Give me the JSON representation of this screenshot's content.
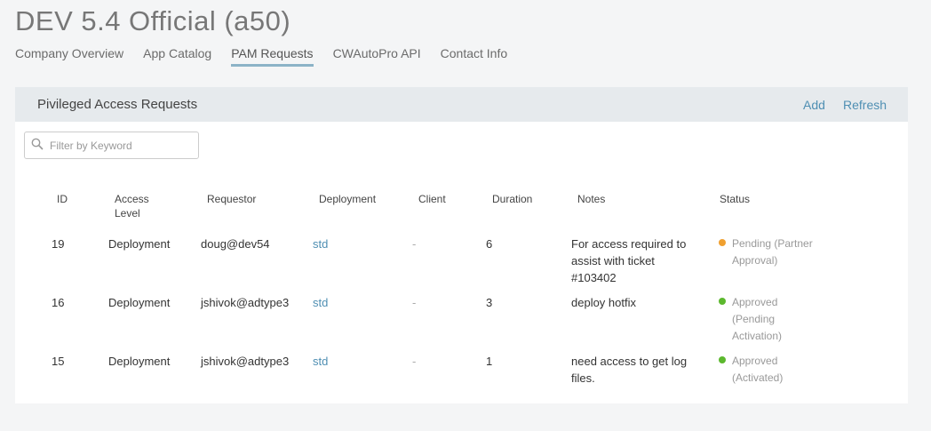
{
  "app": {
    "title": "DEV 5.4 Official (a50)"
  },
  "tabs": [
    {
      "label": "Company Overview"
    },
    {
      "label": "App Catalog"
    },
    {
      "label": "PAM Requests"
    },
    {
      "label": "CWAutoPro API"
    },
    {
      "label": "Contact Info"
    }
  ],
  "active_tab": "PAM Requests",
  "panel": {
    "title": "Pivileged Access Requests",
    "add_label": "Add",
    "refresh_label": "Refresh"
  },
  "search": {
    "placeholder": "Filter by Keyword",
    "value": ""
  },
  "columns": [
    "ID",
    "Access\nLevel",
    "Requestor",
    "Deployment",
    "Client",
    "Duration",
    "Notes",
    "Status"
  ],
  "rows": [
    {
      "id": "19",
      "access_level": "Deployment",
      "requestor": "doug@dev54",
      "deployment": "std",
      "client": "-",
      "duration": "6",
      "notes": "For access required to assist with ticket #103402",
      "status": "Pending (Partner Approval)",
      "status_color": "#f0a030"
    },
    {
      "id": "16",
      "access_level": "Deployment",
      "requestor": "jshivok@adtype3",
      "deployment": "std",
      "client": "-",
      "duration": "3",
      "notes": "deploy hotfix",
      "status": "Approved (Pending Activation)",
      "status_color": "#5cb82e"
    },
    {
      "id": "15",
      "access_level": "Deployment",
      "requestor": "jshivok@adtype3",
      "deployment": "std",
      "client": "-",
      "duration": "1",
      "notes": "need access to get log files.",
      "status": "Approved (Activated)",
      "status_color": "#5cb82e"
    }
  ],
  "icons": {
    "search": "search-icon"
  }
}
